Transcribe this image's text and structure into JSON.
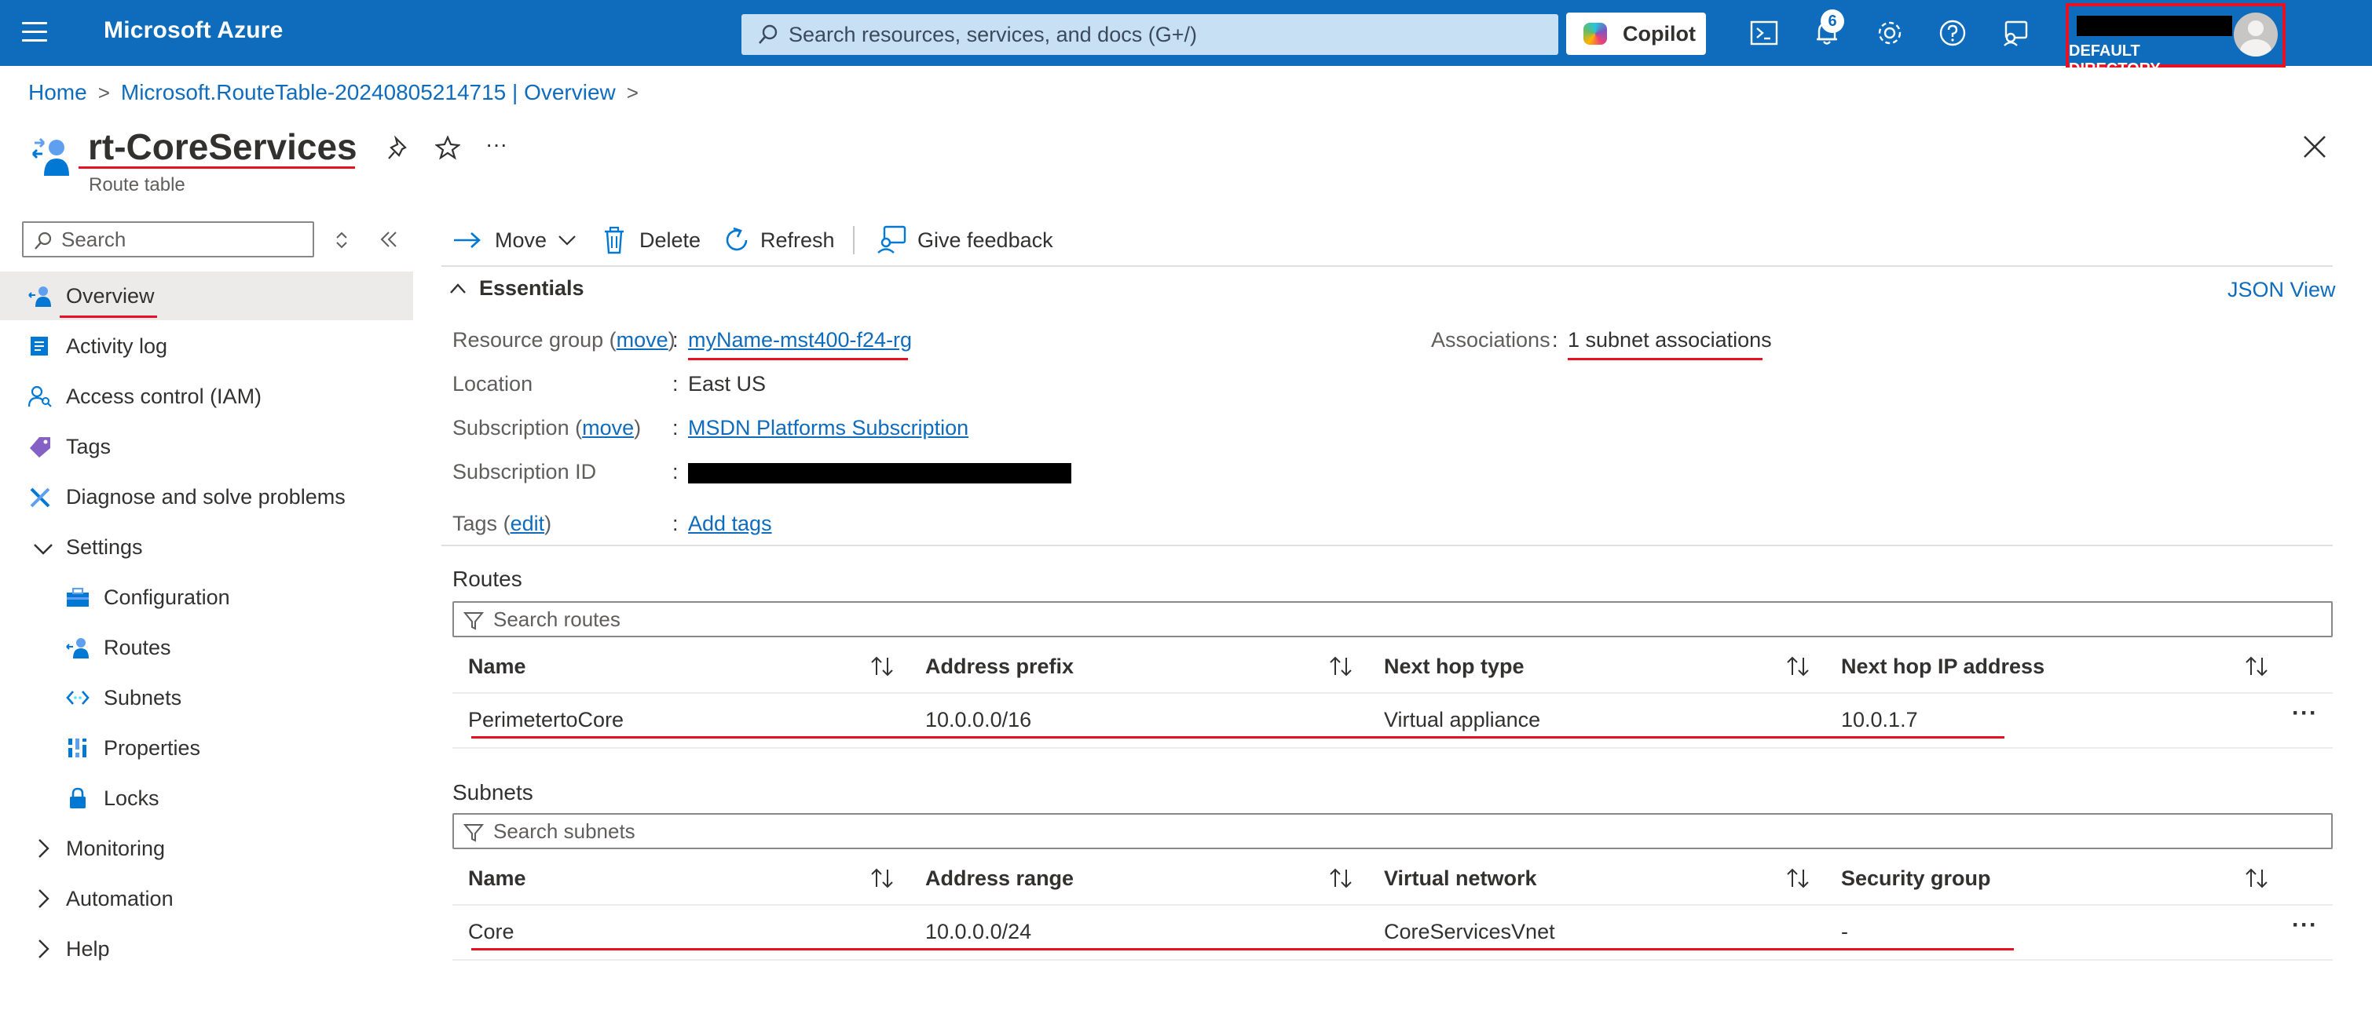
{
  "topbar": {
    "brand": "Microsoft Azure",
    "search_placeholder": "Search resources, services, and docs (G+/)",
    "copilot_label": "Copilot",
    "notifications_count": "6",
    "directory_label": "DEFAULT DIRECTORY"
  },
  "breadcrumb": {
    "home": "Home",
    "parent": "Microsoft.RouteTable-20240805214715 | Overview"
  },
  "header": {
    "title": "rt-CoreServices",
    "subtitle": "Route table",
    "more_label": "···"
  },
  "sidebar": {
    "search_placeholder": "Search",
    "items": [
      {
        "label": "Overview",
        "icon": "route-table-icon"
      },
      {
        "label": "Activity log",
        "icon": "activity-log-icon"
      },
      {
        "label": "Access control (IAM)",
        "icon": "iam-icon"
      },
      {
        "label": "Tags",
        "icon": "tag-icon"
      },
      {
        "label": "Diagnose and solve problems",
        "icon": "wrench-icon"
      },
      {
        "label": "Settings",
        "icon": "chevron-down-icon"
      },
      {
        "label": "Configuration",
        "icon": "toolbox-icon"
      },
      {
        "label": "Routes",
        "icon": "routes-icon"
      },
      {
        "label": "Subnets",
        "icon": "subnet-icon"
      },
      {
        "label": "Properties",
        "icon": "properties-icon"
      },
      {
        "label": "Locks",
        "icon": "lock-icon"
      },
      {
        "label": "Monitoring",
        "icon": "chevron-right-icon"
      },
      {
        "label": "Automation",
        "icon": "chevron-right-icon"
      },
      {
        "label": "Help",
        "icon": "chevron-right-icon"
      }
    ]
  },
  "commands": {
    "move": "Move",
    "delete": "Delete",
    "refresh": "Refresh",
    "feedback": "Give feedback"
  },
  "essentials": {
    "heading": "Essentials",
    "json_view": "JSON View",
    "resource_group_label": "Resource group",
    "move_link": "move",
    "resource_group_value": "myName-mst400-f24-rg",
    "location_label": "Location",
    "location_value": "East US",
    "subscription_label": "Subscription",
    "subscription_value": "MSDN Platforms Subscription",
    "subscription_id_label": "Subscription ID",
    "tags_label": "Tags",
    "edit_link": "edit",
    "tags_value": "Add tags",
    "associations_label": "Associations",
    "associations_value": "1 subnet associations",
    "colon": ":",
    "open_paren": "(",
    "close_paren": ")"
  },
  "routes": {
    "heading": "Routes",
    "filter_placeholder": "Search routes",
    "columns": [
      "Name",
      "Address prefix",
      "Next hop type",
      "Next hop IP address"
    ],
    "rows": [
      {
        "name": "PerimetertoCore",
        "prefix": "10.0.0.0/16",
        "hop_type": "Virtual appliance",
        "hop_ip": "10.0.1.7"
      }
    ]
  },
  "subnets": {
    "heading": "Subnets",
    "filter_placeholder": "Search subnets",
    "columns": [
      "Name",
      "Address range",
      "Virtual network",
      "Security group"
    ],
    "rows": [
      {
        "name": "Core",
        "range": "10.0.0.0/24",
        "vnet": "CoreServicesVnet",
        "nsg": "-"
      }
    ]
  },
  "colors": {
    "azure_blue": "#0f6cbd",
    "annotation_red": "#e81123"
  }
}
